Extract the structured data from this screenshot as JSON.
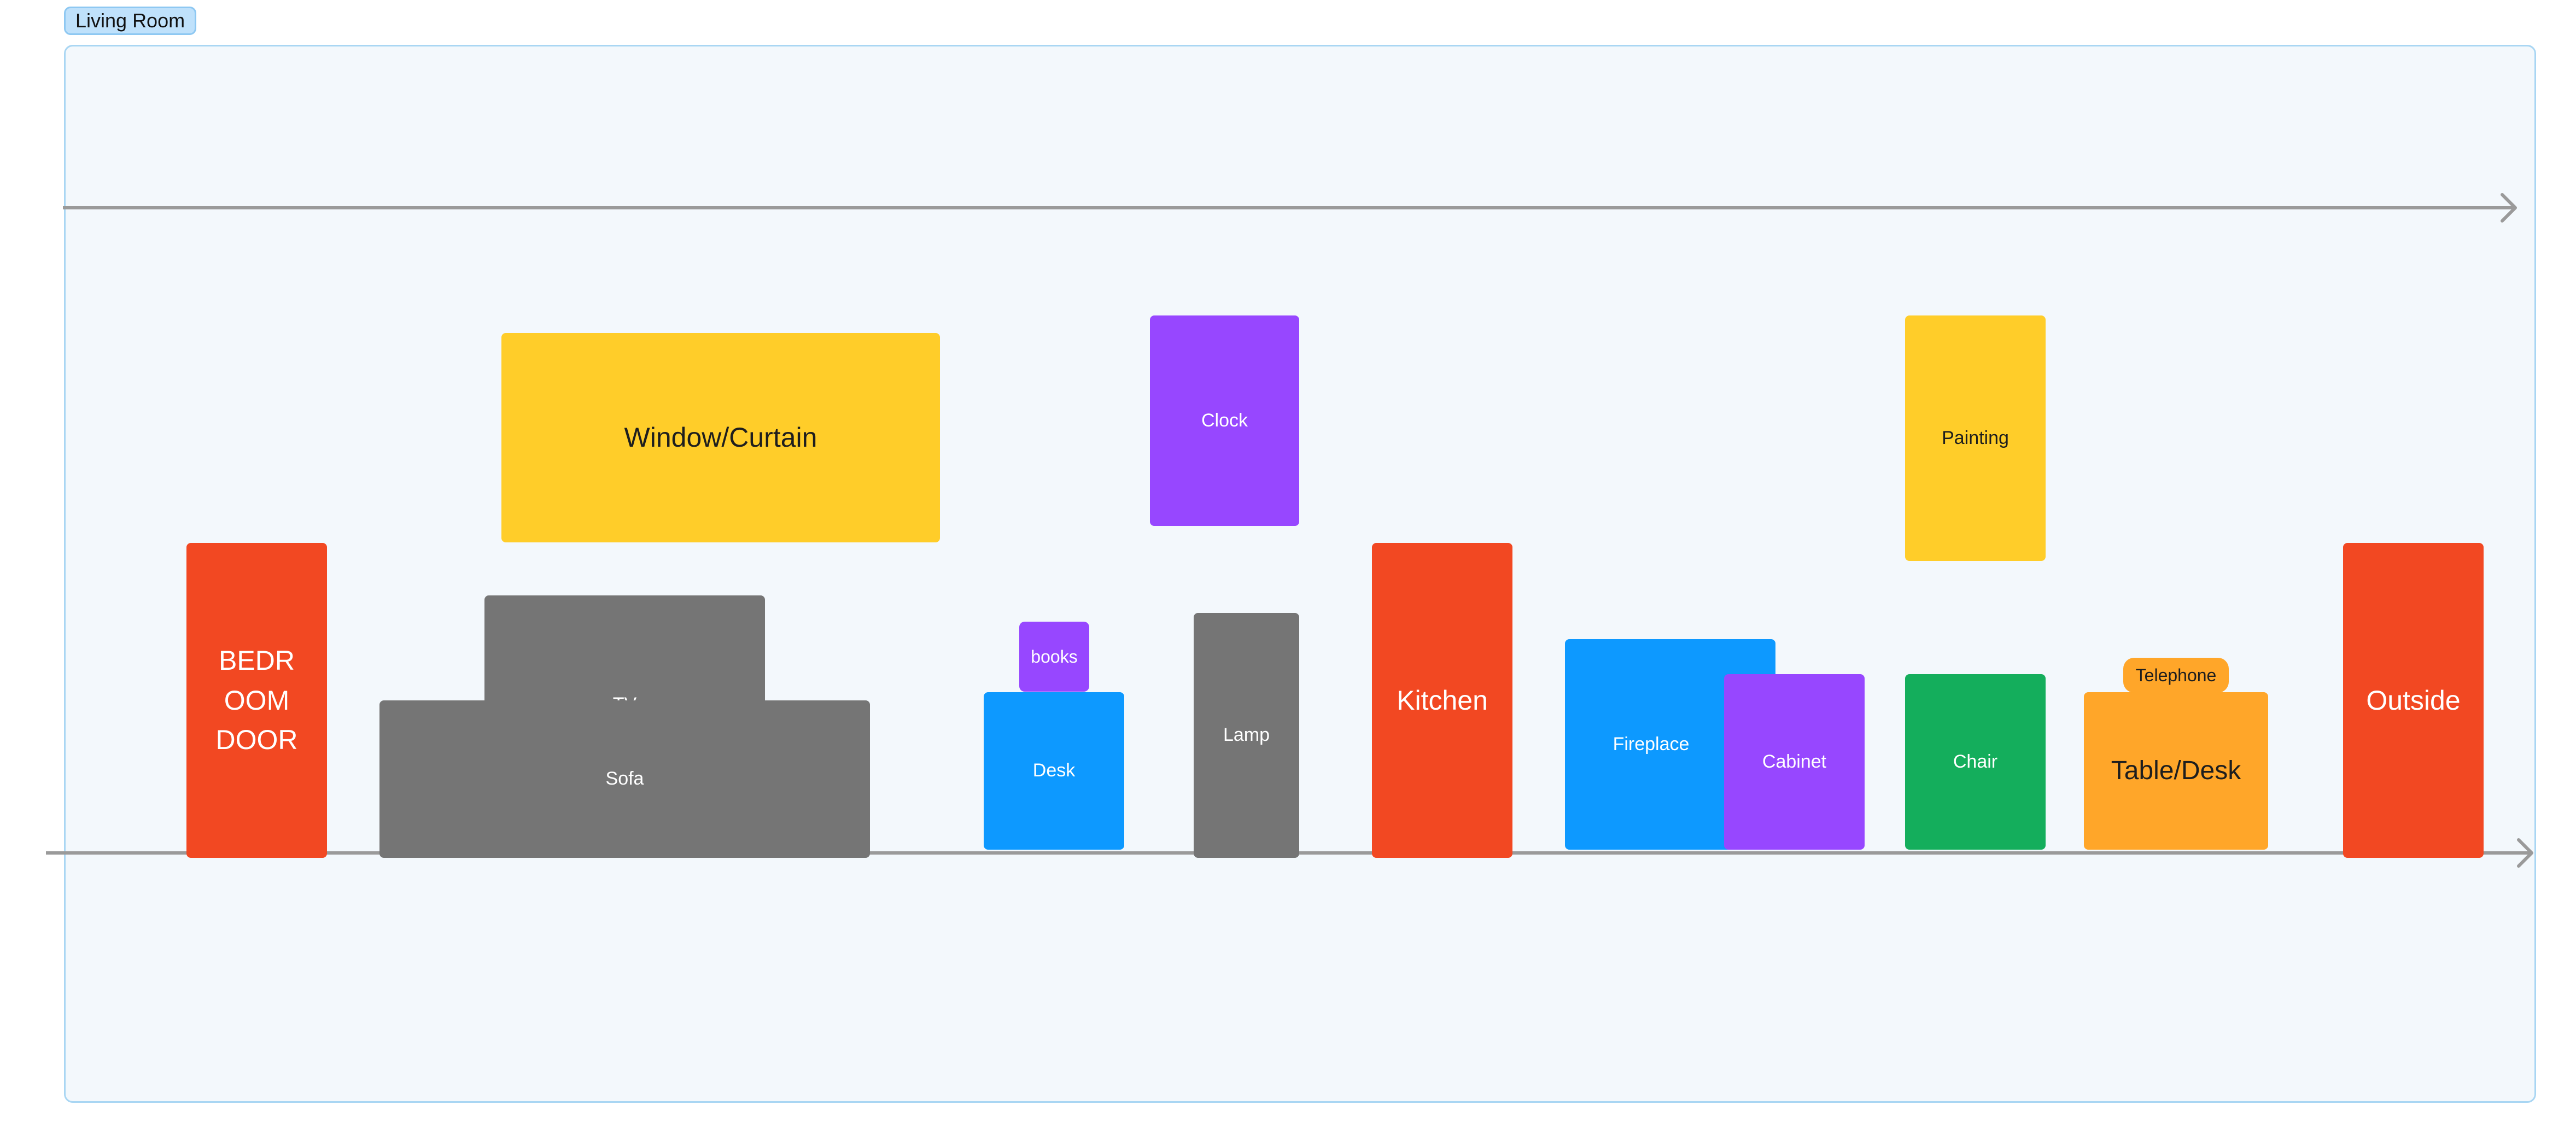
{
  "frame": {
    "title": "Living Room"
  },
  "colors": {
    "frame_background": "#f3f8fc",
    "frame_border": "#a9d6f3",
    "connector": "#9a9a9a",
    "red": "#f24822",
    "yellow": "#ffcd29",
    "purple": "#9747ff",
    "gray": "#757575",
    "blue": "#0d99ff",
    "green": "#14ae5c",
    "orange": "#ffa629"
  },
  "stickies": {
    "bedroom_door": "BEDR\nOOM\nDOOR",
    "window_curtain": "Window/Curtain",
    "tv": "TV",
    "sofa": "Sofa",
    "books": "books",
    "desk": "Desk",
    "clock": "Clock",
    "lamp": "Lamp",
    "kitchen": "Kitchen",
    "fireplace": "Fireplace",
    "cabinet": "Cabinet",
    "painting": "Painting",
    "chair": "Chair",
    "telephone": "Telephone",
    "table_desk": "Table/Desk",
    "outside": "Outside"
  },
  "connectors": [
    {
      "name": "top-arrow",
      "arrowhead": "right"
    },
    {
      "name": "floor-arrow",
      "arrowhead": "right"
    }
  ]
}
